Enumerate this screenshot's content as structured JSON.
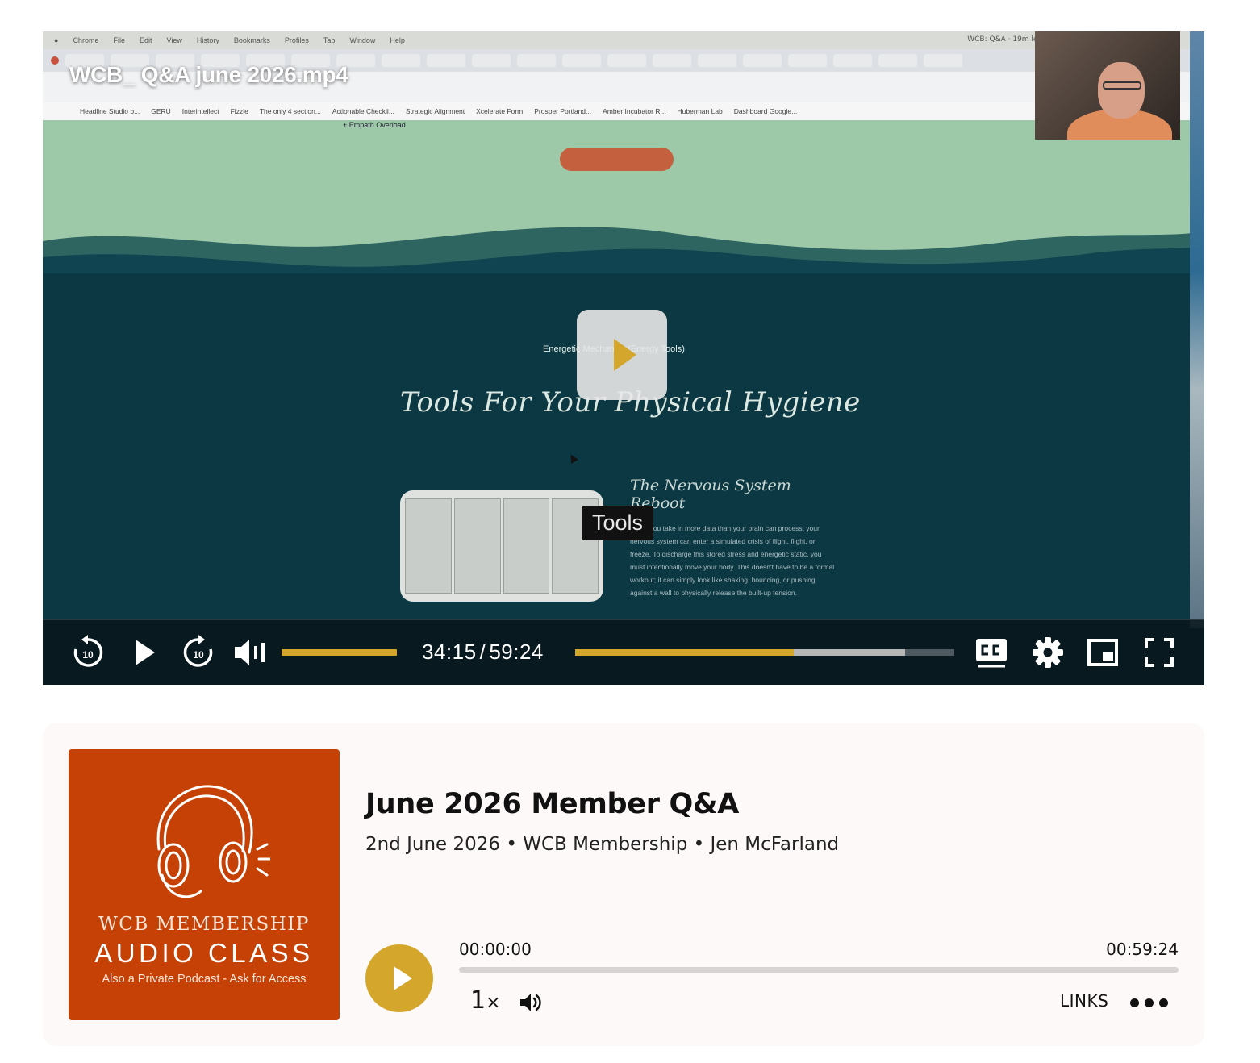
{
  "video": {
    "title": "WCB_ Q&A june 2026.mp4",
    "tooltip": "Tools",
    "time_current": "34:15",
    "time_separator": "/",
    "time_total": "59:24",
    "progress_played_fraction": 0.576,
    "progress_buffered_fraction": 0.87,
    "volume_fraction": 1.0,
    "skip_back_seconds": "10",
    "skip_forward_seconds": "10",
    "accent_color": "#d4a72c",
    "icons": [
      "replay-10-icon",
      "play-icon",
      "forward-10-icon",
      "volume-icon",
      "closed-captions-icon",
      "settings-gear-icon",
      "picture-in-picture-icon",
      "fullscreen-icon"
    ],
    "screen_share": {
      "menubar": [
        "Chrome",
        "File",
        "Edit",
        "View",
        "History",
        "Bookmarks",
        "Profiles",
        "Tab",
        "Window",
        "Help"
      ],
      "status_text": "WCB: Q&A · 19m left",
      "bookmarks": [
        "Headline Studio b...",
        "GERU",
        "Interintellect",
        "Fizzle",
        "The only 4 section...",
        "Actionable Checkli...",
        "Strategic Alignment",
        "Xcelerate Form",
        "Prosper Portland...",
        "Amber Incubator R...",
        "Huberman Lab",
        "Dashboard Google..."
      ],
      "empath_link": "+ Empath Overload",
      "section_label": "Energetic Mechanics (Energy Tools)",
      "heading": "Tools For Your Physical Hygiene",
      "card_title": "The Nervous System Reboot",
      "card_body": "When you take in more data than your brain can process, your nervous system can enter a simulated crisis of flight, flight, or freeze. To discharge this stored stress and energetic static, you must intentionally move your body. This doesn't have to be a formal workout; it can simply look like shaking, bouncing, or pushing against a wall to physically release the built-up tension."
    }
  },
  "audio": {
    "cover": {
      "line1": "WCB MEMBERSHIP",
      "line2": "AUDIO CLASS",
      "line3": "Also a Private Podcast - Ask for Access",
      "background": "#c54105",
      "icon": "headphones-icon"
    },
    "title": "June 2026 Member Q&A",
    "meta": "2nd June 2026 • WCB Membership • Jen McFarland",
    "time_current": "00:00:00",
    "time_total": "00:59:24",
    "progress_fraction": 0,
    "speed_value": "1",
    "speed_suffix": "×",
    "links_label": "LINKS",
    "play_color": "#d4a72c",
    "icons": [
      "play-icon",
      "speaker-icon",
      "more-dots-icon"
    ]
  }
}
